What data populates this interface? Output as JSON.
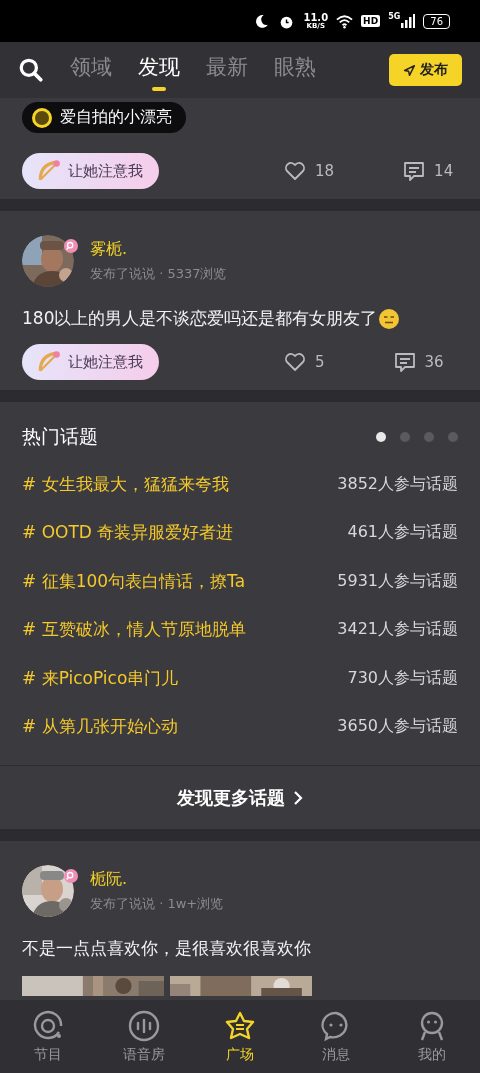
{
  "status_bar": {
    "speed": "11.0",
    "speed_unit": "KB/S",
    "hd": "HD",
    "network": "5G",
    "battery": "76"
  },
  "header": {
    "tabs": [
      {
        "label": "领域",
        "selected": false
      },
      {
        "label": "发现",
        "selected": true
      },
      {
        "label": "最新",
        "selected": false
      },
      {
        "label": "眼熟",
        "selected": false
      }
    ],
    "publish_button": "发布"
  },
  "posts": [
    {
      "tag": "爱自拍的小漂亮",
      "attention_button": "让她注意我",
      "likes": "18",
      "comments": "14"
    },
    {
      "author": "雾栀.",
      "meta": "发布了说说 · 5337浏览",
      "text": "180以上的男人是不谈恋爱吗还是都有女朋友了",
      "emoji": true,
      "attention_button": "让她注意我",
      "likes": "5",
      "comments": "36"
    }
  ],
  "hot_topics": {
    "title": "热门话题",
    "pager": [
      {
        "selected": true
      },
      {
        "selected": false
      },
      {
        "selected": false
      },
      {
        "selected": false
      }
    ],
    "topics": [
      {
        "name": "# 女生我最大，猛猛来夸我",
        "count": "3852人参与话题"
      },
      {
        "name": "# OOTD 奇装异服爱好者进",
        "count": "461人参与话题"
      },
      {
        "name": "# 征集100句表白情话，撩Ta",
        "count": "5931人参与话题"
      },
      {
        "name": "# 互赞破冰，情人节原地脱单",
        "count": "3421人参与话题"
      },
      {
        "name": "# 来PicoPico串门儿",
        "count": "730人参与话题"
      },
      {
        "name": "# 从第几张开始心动",
        "count": "3650人参与话题"
      }
    ],
    "more": "发现更多话题"
  },
  "last_post": {
    "author": "栀阮.",
    "meta": "发布了说说 · 1w+浏览",
    "text": "不是一点点喜欢你，是很喜欢很喜欢你"
  },
  "bottom_nav": [
    {
      "label": "节目",
      "kind": "program",
      "selected": false
    },
    {
      "label": "语音房",
      "kind": "voice",
      "selected": false
    },
    {
      "label": "广场",
      "kind": "square",
      "selected": true
    },
    {
      "label": "消息",
      "kind": "message",
      "selected": false
    },
    {
      "label": "我的",
      "kind": "me",
      "selected": false
    }
  ]
}
